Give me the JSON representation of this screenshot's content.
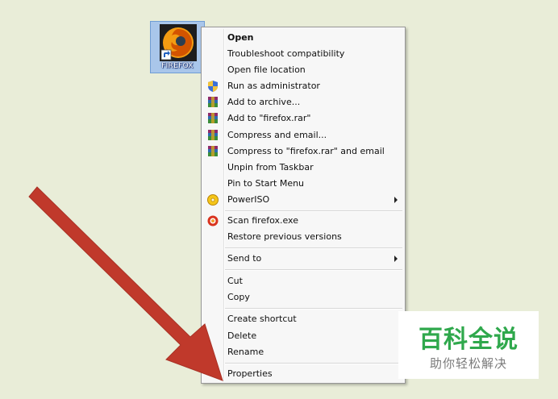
{
  "desktop_icon": {
    "label": "FIREFOX",
    "icon": "firefox-shortcut-icon"
  },
  "context_menu": {
    "items": [
      {
        "label": "Open",
        "bold": true
      },
      {
        "label": "Troubleshoot compatibility"
      },
      {
        "label": "Open file location"
      },
      {
        "label": "Run as administrator",
        "icon": "uac-shield-icon"
      },
      {
        "label": "Add to archive...",
        "icon": "winrar-icon"
      },
      {
        "label": "Add to \"firefox.rar\"",
        "icon": "winrar-icon"
      },
      {
        "label": "Compress and email...",
        "icon": "winrar-icon"
      },
      {
        "label": "Compress to \"firefox.rar\" and email",
        "icon": "winrar-icon"
      },
      {
        "label": "Unpin from Taskbar"
      },
      {
        "label": "Pin to Start Menu"
      },
      {
        "label": "PowerISO",
        "icon": "poweriso-icon",
        "submenu": true
      },
      {
        "label": "Scan firefox.exe",
        "icon": "antivirus-icon"
      },
      {
        "label": "Restore previous versions"
      },
      {
        "label": "Send to",
        "submenu": true
      },
      {
        "label": "Cut"
      },
      {
        "label": "Copy"
      },
      {
        "label": "Create shortcut"
      },
      {
        "label": "Delete"
      },
      {
        "label": "Rename"
      },
      {
        "label": "Properties"
      }
    ]
  },
  "annotation": {
    "arrow_color": "#c0392b",
    "points_to": "Properties"
  },
  "watermark": {
    "title": "百科全说",
    "subtitle": "助你轻松解决"
  },
  "colors": {
    "desktop_bg": "#e9edd8",
    "menu_bg": "#f7f7f7",
    "watermark_green": "#2fa84c"
  }
}
